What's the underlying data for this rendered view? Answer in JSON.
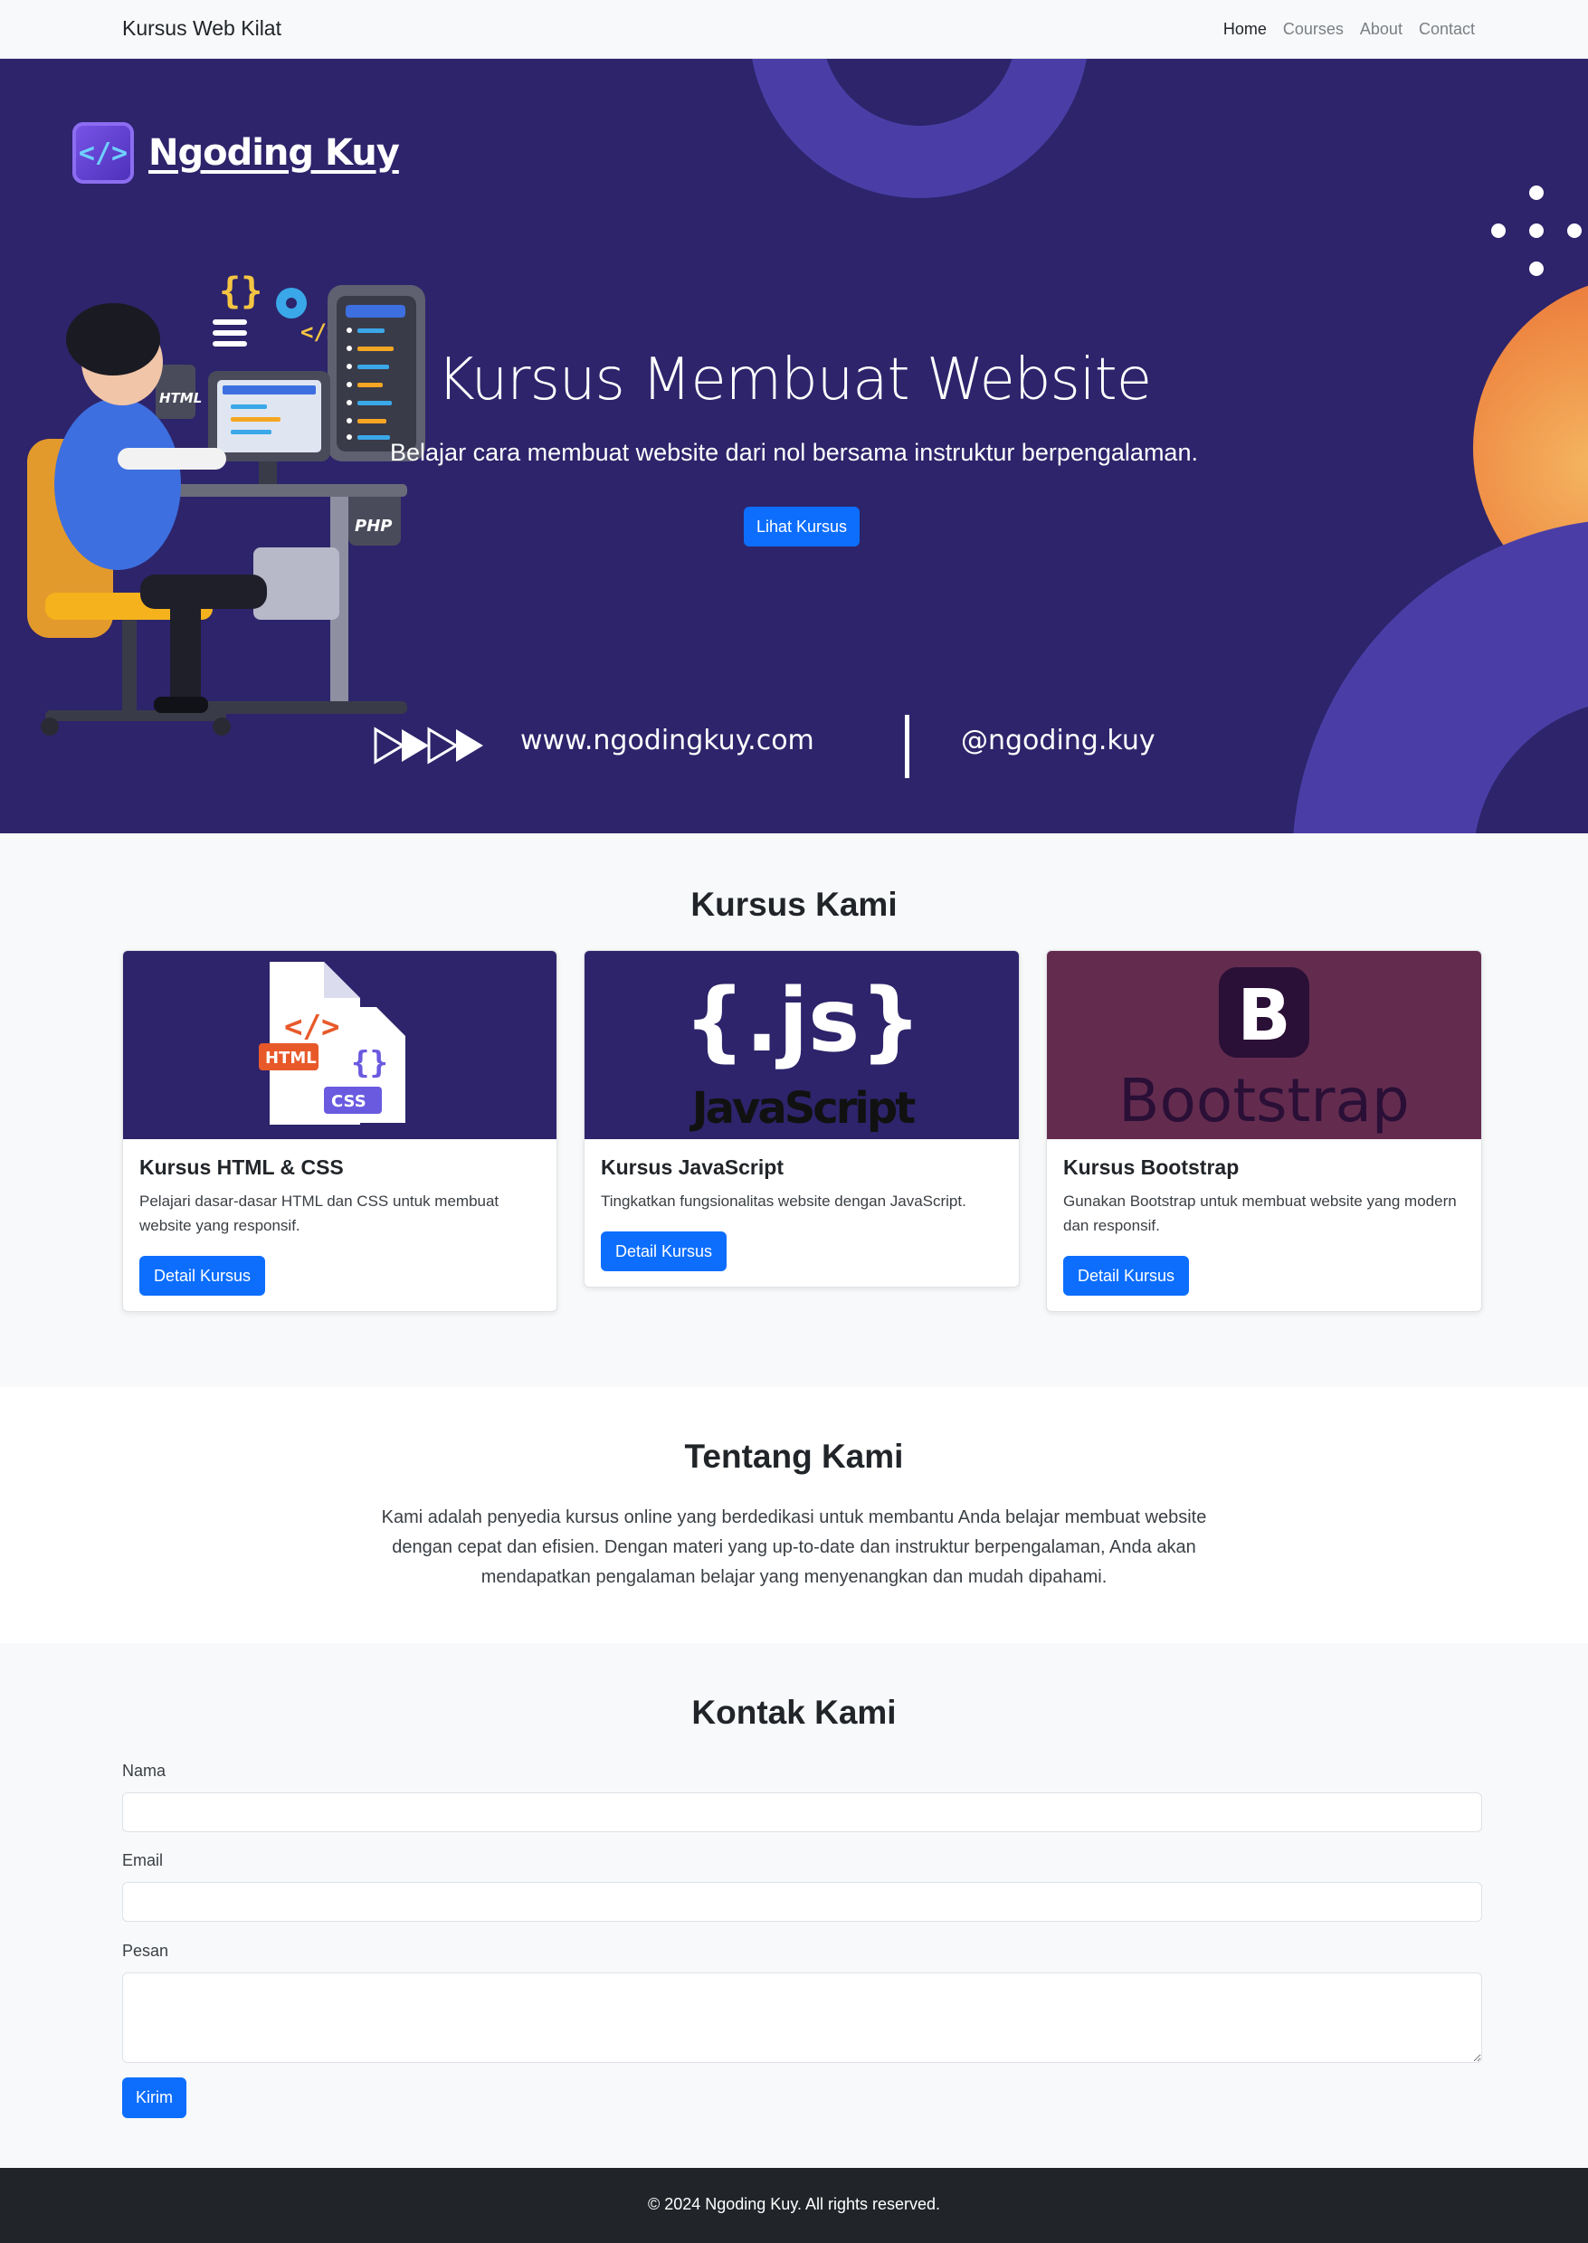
{
  "navbar": {
    "brand": "Kursus Web Kilat",
    "links": [
      {
        "label": "Home",
        "active": true
      },
      {
        "label": "Courses",
        "active": false
      },
      {
        "label": "About",
        "active": false
      },
      {
        "label": "Contact",
        "active": false
      }
    ]
  },
  "hero": {
    "logo_text": "Ngoding Kuy",
    "logo_icon": "code-brackets-icon",
    "title": "Kursus Membuat Website",
    "subtitle": "Belajar cara membuat website dari nol bersama instruktur berpengalaman.",
    "button_label": "Lihat Kursus",
    "website": "www.ngodingkuy.com",
    "handle": "@ngoding.kuy",
    "illustration_labels": [
      "HTML",
      "PHP"
    ],
    "colors": {
      "background": "#2d246b",
      "shape": "#4a3ea6",
      "sun": "#ef8d45"
    }
  },
  "courses": {
    "title": "Kursus Kami",
    "items": [
      {
        "title": "Kursus HTML & CSS",
        "text": "Pelajari dasar-dasar HTML dan CSS untuk membuat website yang responsif.",
        "button": "Detail Kursus",
        "image_labels": [
          "HTML",
          "CSS"
        ]
      },
      {
        "title": "Kursus JavaScript",
        "text": "Tingkatkan fungsionalitas website dengan JavaScript.",
        "button": "Detail Kursus",
        "image_labels": [
          "{.js}",
          "JavaScript"
        ]
      },
      {
        "title": "Kursus Bootstrap",
        "text": "Gunakan Bootstrap untuk membuat website yang modern dan responsif.",
        "button": "Detail Kursus",
        "image_labels": [
          "B",
          "Bootstrap"
        ]
      }
    ]
  },
  "about": {
    "title": "Tentang Kami",
    "text": "Kami adalah penyedia kursus online yang berdedikasi untuk membantu Anda belajar membuat website dengan cepat dan efisien. Dengan materi yang up-to-date dan instruktur berpengalaman, Anda akan mendapatkan pengalaman belajar yang menyenangkan dan mudah dipahami."
  },
  "contact": {
    "title": "Kontak Kami",
    "fields": [
      {
        "label": "Nama",
        "value": ""
      },
      {
        "label": "Email",
        "value": ""
      },
      {
        "label": "Pesan",
        "value": ""
      }
    ],
    "submit_label": "Kirim"
  },
  "footer": {
    "text": "© 2024 Ngoding Kuy. All rights reserved."
  },
  "colors": {
    "primary": "#0d6efd",
    "footer": "#212529"
  }
}
